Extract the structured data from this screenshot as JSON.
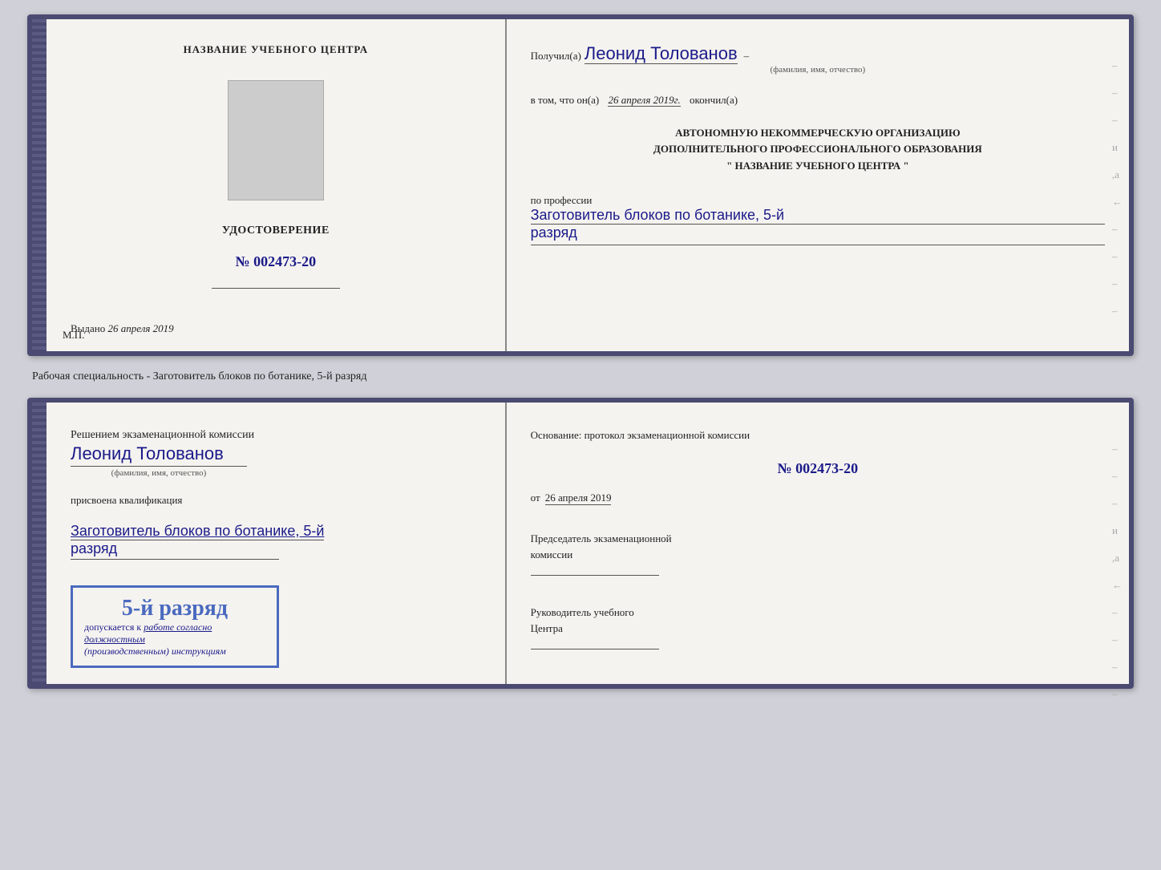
{
  "doc1": {
    "left": {
      "center_title": "НАЗВАНИЕ УЧЕБНОГО ЦЕНТРА",
      "cert_label": "УДОСТОВЕРЕНИЕ",
      "cert_number": "№ 002473-20",
      "issued_label": "Выдано",
      "issued_date": "26 апреля 2019",
      "mp_label": "М.П."
    },
    "right": {
      "recipient_prefix": "Получил(а)",
      "recipient_name": "Леонид Толованов",
      "fio_label": "(фамилия, имя, отчество)",
      "date_prefix": "в том, что он(а)",
      "date_value": "26 апреля 2019г.",
      "date_suffix": "окончил(а)",
      "org_line1": "АВТОНОМНУЮ НЕКОММЕРЧЕСКУЮ ОРГАНИЗАЦИЮ",
      "org_line2": "ДОПОЛНИТЕЛЬНОГО ПРОФЕССИОНАЛЬНОГО ОБРАЗОВАНИЯ",
      "org_line3": "\" НАЗВАНИЕ УЧЕБНОГО ЦЕНТРА \"",
      "profession_label": "по профессии",
      "profession_value": "Заготовитель блоков по ботанике, 5-й",
      "razryad_value": "разряд"
    }
  },
  "separator": "Рабочая специальность - Заготовитель блоков по ботанике, 5-й разряд",
  "doc2": {
    "left": {
      "komissia_prefix": "Решением экзаменационной комиссии",
      "komissia_name": "Леонид Толованов",
      "fio_label": "(фамилия, имя, отчество)",
      "prisvoena_text": "присвоена квалификация",
      "kvali_value": "Заготовитель блоков по ботанике, 5-й",
      "razryad_value": "разряд",
      "stamp_rank": "5-й разряд",
      "stamp_dopusk": "допускается к",
      "stamp_work": "работе согласно должностным",
      "stamp_instr": "(производственным) инструкциям"
    },
    "right": {
      "osnov_label": "Основание: протокол экзаменационной комиссии",
      "proto_number": "№  002473-20",
      "ot_prefix": "от",
      "ot_date": "26 апреля 2019",
      "chairman_line1": "Председатель экзаменационной",
      "chairman_line2": "комиссии",
      "rukov_line1": "Руководитель учебного",
      "rukov_line2": "Центра"
    }
  }
}
